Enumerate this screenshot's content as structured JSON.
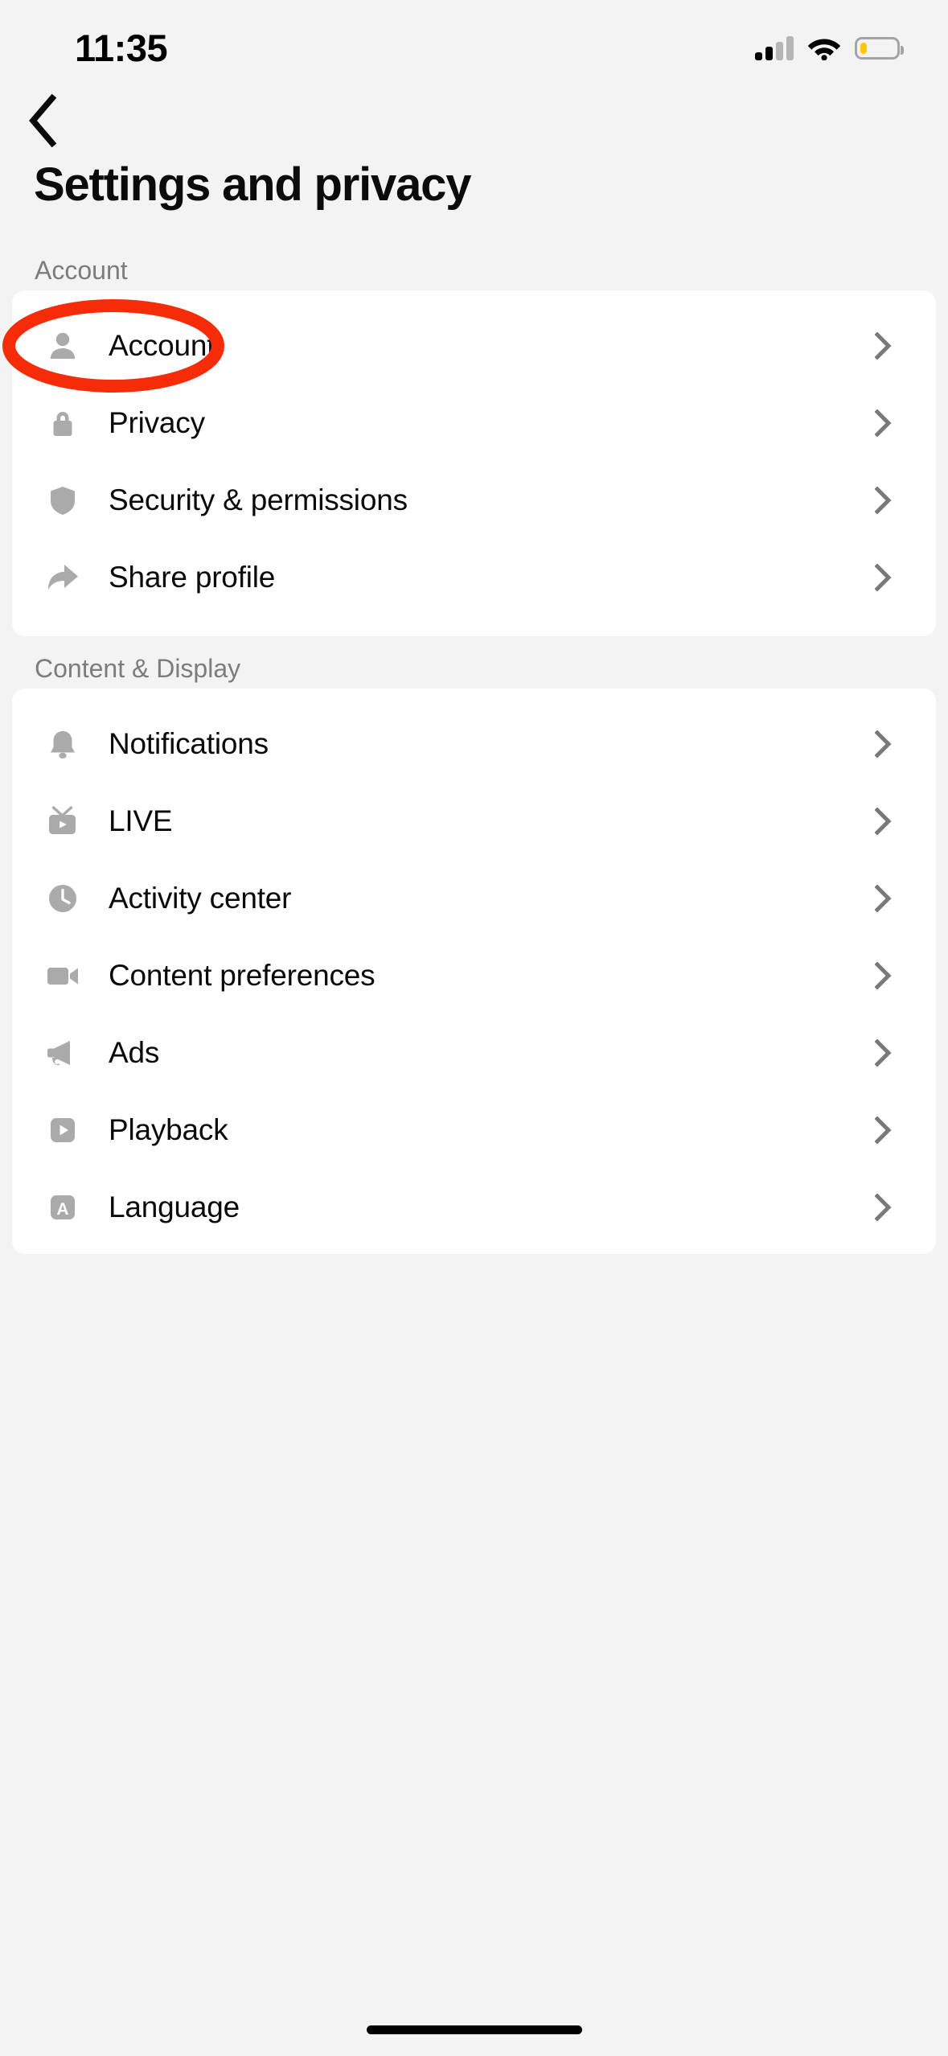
{
  "status_bar": {
    "time": "11:35",
    "cellular_icon": "cellular-signal-icon",
    "cellular_bars_active": 2,
    "cellular_bars_total": 4,
    "wifi_icon": "wifi-icon",
    "battery_icon": "battery-low-icon",
    "battery_fill_color": "#ffc800",
    "battery_outline_color": "#a5a5a5"
  },
  "nav": {
    "back_icon": "chevron-left-icon",
    "title": "Settings and privacy"
  },
  "annotation": {
    "shape": "ellipse",
    "color": "#f62c09",
    "target": "Account"
  },
  "sections": [
    {
      "header": "Account",
      "rows": [
        {
          "label": "Account",
          "icon": "person-icon",
          "chevron": "chevron-right-icon"
        },
        {
          "label": "Privacy",
          "icon": "lock-icon",
          "chevron": "chevron-right-icon"
        },
        {
          "label": "Security & permissions",
          "icon": "shield-icon",
          "chevron": "chevron-right-icon"
        },
        {
          "label": "Share profile",
          "icon": "share-arrow-icon",
          "chevron": "chevron-right-icon"
        }
      ]
    },
    {
      "header": "Content & Display",
      "rows": [
        {
          "label": "Notifications",
          "icon": "bell-icon",
          "chevron": "chevron-right-icon"
        },
        {
          "label": "LIVE",
          "icon": "live-tv-icon",
          "chevron": "chevron-right-icon"
        },
        {
          "label": "Activity center",
          "icon": "clock-icon",
          "chevron": "chevron-right-icon"
        },
        {
          "label": "Content preferences",
          "icon": "video-camera-icon",
          "chevron": "chevron-right-icon"
        },
        {
          "label": "Ads",
          "icon": "megaphone-icon",
          "chevron": "chevron-right-icon"
        },
        {
          "label": "Playback",
          "icon": "play-square-icon",
          "chevron": "chevron-right-icon"
        },
        {
          "label": "Language",
          "icon": "language-a-icon",
          "chevron": "chevron-right-icon"
        }
      ]
    }
  ],
  "home_indicator": "home-indicator"
}
